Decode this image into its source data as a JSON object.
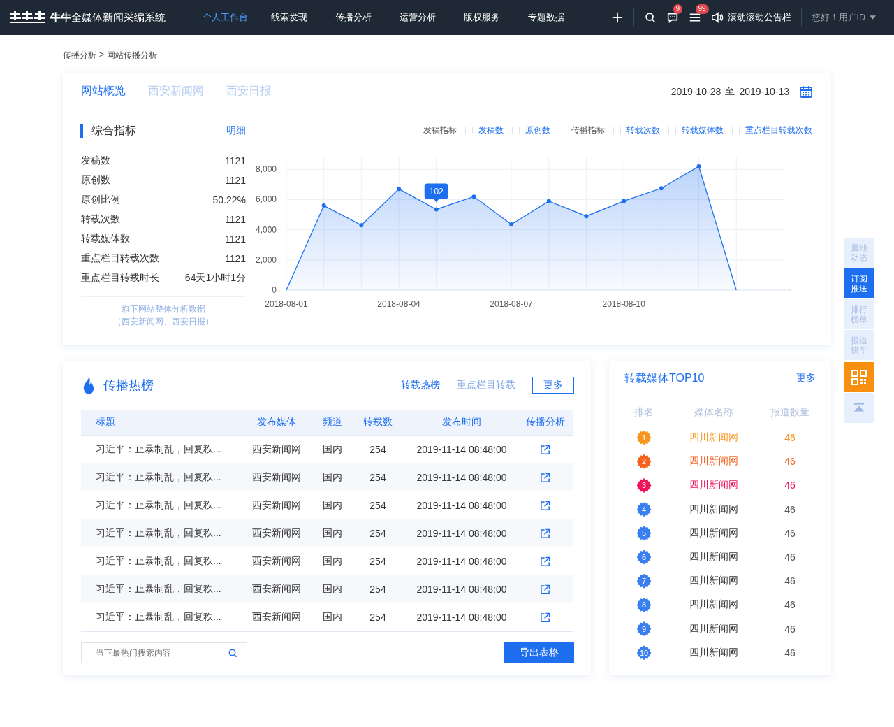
{
  "header": {
    "logo_text": "**牛牛**全媒体新闻采编系统",
    "nav": [
      {
        "label": "个人工作台",
        "selected": true
      },
      {
        "label": "线索发现",
        "selected": false
      },
      {
        "label": "传播分析",
        "selected": false
      },
      {
        "label": "运营分析",
        "selected": false
      },
      {
        "label": "版权服务",
        "selected": false
      },
      {
        "label": "专题数据",
        "selected": false
      }
    ],
    "message_badge": "9",
    "menu_badge": "99",
    "announcement": "滚动滚动公告栏",
    "greeting": "您好！用户ID"
  },
  "breadcrumb": {
    "items": [
      "传播分析",
      "网站传播分析"
    ],
    "separator": ">"
  },
  "overview": {
    "tabs": [
      {
        "label": "网站概览",
        "selected": true
      },
      {
        "label": "西安新闻网",
        "selected": false
      },
      {
        "label": "西安日报",
        "selected": false
      }
    ],
    "date_from": "2019-10-28",
    "date_sep": "至",
    "date_to": "2019-10-13",
    "metrics_title": "综合指标",
    "detail_link": "明细",
    "metrics": [
      {
        "label": "发稿数",
        "value": "1121"
      },
      {
        "label": "原创数",
        "value": "1121"
      },
      {
        "label": "原创比例",
        "value": "50.22%"
      },
      {
        "label": "转载次数",
        "value": "1121"
      },
      {
        "label": "转载媒体数",
        "value": "1121"
      },
      {
        "label": "重点栏目转载次数",
        "value": "1121"
      },
      {
        "label": "重点栏目转载时长",
        "value": "64天1小时1分"
      }
    ],
    "note": [
      "旗下网站整体分析数据",
      "（西安新闻网、西安日报）"
    ],
    "legend_groups": [
      {
        "title": "发稿指标",
        "options": [
          {
            "label": "发稿数",
            "checked": false
          },
          {
            "label": "原创数",
            "checked": false
          }
        ]
      },
      {
        "title": "传播指标",
        "options": [
          {
            "label": "转载次数",
            "checked": false
          },
          {
            "label": "转载媒体数",
            "checked": false
          },
          {
            "label": "重点栏目转载次数",
            "checked": false
          }
        ]
      }
    ],
    "chart_data": {
      "type": "area",
      "categories": [
        "2018-08-01",
        null,
        null,
        "2018-08-04",
        null,
        null,
        "2018-08-07",
        null,
        null,
        "2018-08-10",
        null,
        null,
        null
      ],
      "series": [
        {
          "color": "#1e6ff0",
          "values": [
            0,
            5600,
            4300,
            6700,
            5350,
            6200,
            4350,
            5900,
            4900,
            5900,
            6750,
            8200,
            0
          ]
        }
      ],
      "ylim": [
        0,
        8800
      ],
      "yticks": [
        {
          "value": 0,
          "label": "0"
        },
        {
          "value": 2000,
          "label": "2,000"
        },
        {
          "value": 4000,
          "label": "4,000"
        },
        {
          "value": 6000,
          "label": "6,000"
        },
        {
          "value": 8000,
          "label": "8,000"
        }
      ],
      "grid": true,
      "annotations": [
        {
          "y": 5350,
          "text": "102"
        }
      ]
    }
  },
  "hot": {
    "title": "传播热榜",
    "tabs": [
      {
        "label": "转载热榜",
        "selected": true
      },
      {
        "label": "重点栏目转载",
        "selected": false
      }
    ],
    "more": "更多",
    "columns": [
      "标题",
      "发布媒体",
      "频道",
      "转载数",
      "发布时间",
      "传播分析"
    ],
    "rows": [
      {
        "title": "习近平：止暴制乱，回复秩...",
        "media": "西安新闻网",
        "channel": "国内",
        "count": "254",
        "time": "2019-11-14 08:48:00"
      },
      {
        "title": "习近平：止暴制乱，回复秩...",
        "media": "西安新闻网",
        "channel": "国内",
        "count": "254",
        "time": "2019-11-14 08:48:00"
      },
      {
        "title": "习近平：止暴制乱，回复秩...",
        "media": "西安新闻网",
        "channel": "国内",
        "count": "254",
        "time": "2019-11-14 08:48:00"
      },
      {
        "title": "习近平：止暴制乱，回复秩...",
        "media": "西安新闻网",
        "channel": "国内",
        "count": "254",
        "time": "2019-11-14 08:48:00"
      },
      {
        "title": "习近平：止暴制乱，回复秩...",
        "media": "西安新闻网",
        "channel": "国内",
        "count": "254",
        "time": "2019-11-14 08:48:00"
      },
      {
        "title": "习近平：止暴制乱，回复秩...",
        "media": "西安新闻网",
        "channel": "国内",
        "count": "254",
        "time": "2019-11-14 08:48:00"
      },
      {
        "title": "习近平：止暴制乱，回复秩...",
        "media": "西安新闻网",
        "channel": "国内",
        "count": "254",
        "time": "2019-11-14 08:48:00"
      }
    ],
    "search_placeholder": "当下最热门搜索内容",
    "export": "导出表格"
  },
  "top10": {
    "title": "转载媒体TOP10",
    "more": "更多",
    "columns": [
      "排名",
      "媒体名称",
      "报道数量"
    ],
    "rows": [
      {
        "rank": "1",
        "name": "四川新闻网",
        "count": "46",
        "color": "#f7961e",
        "highlight": true
      },
      {
        "rank": "2",
        "name": "四川新闻网",
        "count": "46",
        "color": "#f5621e",
        "highlight": true
      },
      {
        "rank": "3",
        "name": "四川新闻网",
        "count": "46",
        "color": "#ee1258",
        "highlight": true
      },
      {
        "rank": "4",
        "name": "四川新闻网",
        "count": "46",
        "color": "#3a7ff0",
        "highlight": false
      },
      {
        "rank": "5",
        "name": "四川新闻网",
        "count": "46",
        "color": "#3a7ff0",
        "highlight": false
      },
      {
        "rank": "6",
        "name": "四川新闻网",
        "count": "46",
        "color": "#3a7ff0",
        "highlight": false
      },
      {
        "rank": "7",
        "name": "四川新闻网",
        "count": "46",
        "color": "#3a7ff0",
        "highlight": false
      },
      {
        "rank": "8",
        "name": "四川新闻网",
        "count": "46",
        "color": "#3a7ff0",
        "highlight": false
      },
      {
        "rank": "9",
        "name": "四川新闻网",
        "count": "46",
        "color": "#3a7ff0",
        "highlight": false
      },
      {
        "rank": "10",
        "name": "四川新闻网",
        "count": "46",
        "color": "#3a7ff0",
        "highlight": false
      }
    ]
  },
  "side_tools": [
    {
      "kind": "text",
      "label": "属地动态",
      "selected": false
    },
    {
      "kind": "text",
      "label": "订阅推送",
      "selected": true
    },
    {
      "kind": "text",
      "label": "排行榜单",
      "selected": false
    },
    {
      "kind": "text",
      "label": "报道快车",
      "selected": false
    },
    {
      "kind": "qr"
    },
    {
      "kind": "top"
    }
  ]
}
